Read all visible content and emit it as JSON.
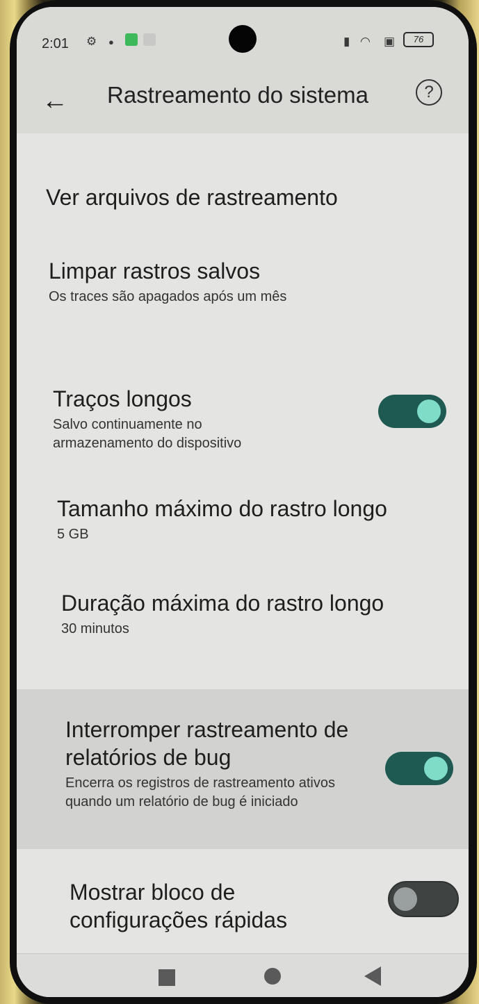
{
  "status_bar": {
    "time": "2:01",
    "battery": "76"
  },
  "app_bar": {
    "title": "Rastreamento do sistema",
    "back_icon": "arrow-left-icon",
    "help_icon": "help-circle-icon",
    "help_glyph": "?"
  },
  "preferences": [
    {
      "title": "Ver arquivos de rastreamento",
      "summary": ""
    },
    {
      "title": "Limpar rastros salvos",
      "summary": "Os traces são apagados após um mês"
    },
    {
      "title": "Traços longos",
      "summary": "Salvo continuamente no armazenamento do dispositivo",
      "toggle": true
    },
    {
      "title": "Tamanho máximo do rastro longo",
      "summary": "5 GB"
    },
    {
      "title": "Duração máxima do rastro longo",
      "summary": "30 minutos"
    },
    {
      "title": "Interromper rastreamento de relatórios de bug",
      "summary": "Encerra os registros de rastreamento ativos quando um relatório de bug é iniciado",
      "toggle": true
    },
    {
      "title": "Mostrar bloco de configurações rápidas",
      "summary": "",
      "toggle": false
    }
  ],
  "colors": {
    "toggle_on_track": "#1f5a52",
    "toggle_on_thumb": "#7fdcc6",
    "toggle_off_track": "#3f4342"
  },
  "nav_bar": {
    "recents_icon": "square-icon",
    "home_icon": "circle-icon",
    "back_icon": "triangle-back-icon"
  }
}
